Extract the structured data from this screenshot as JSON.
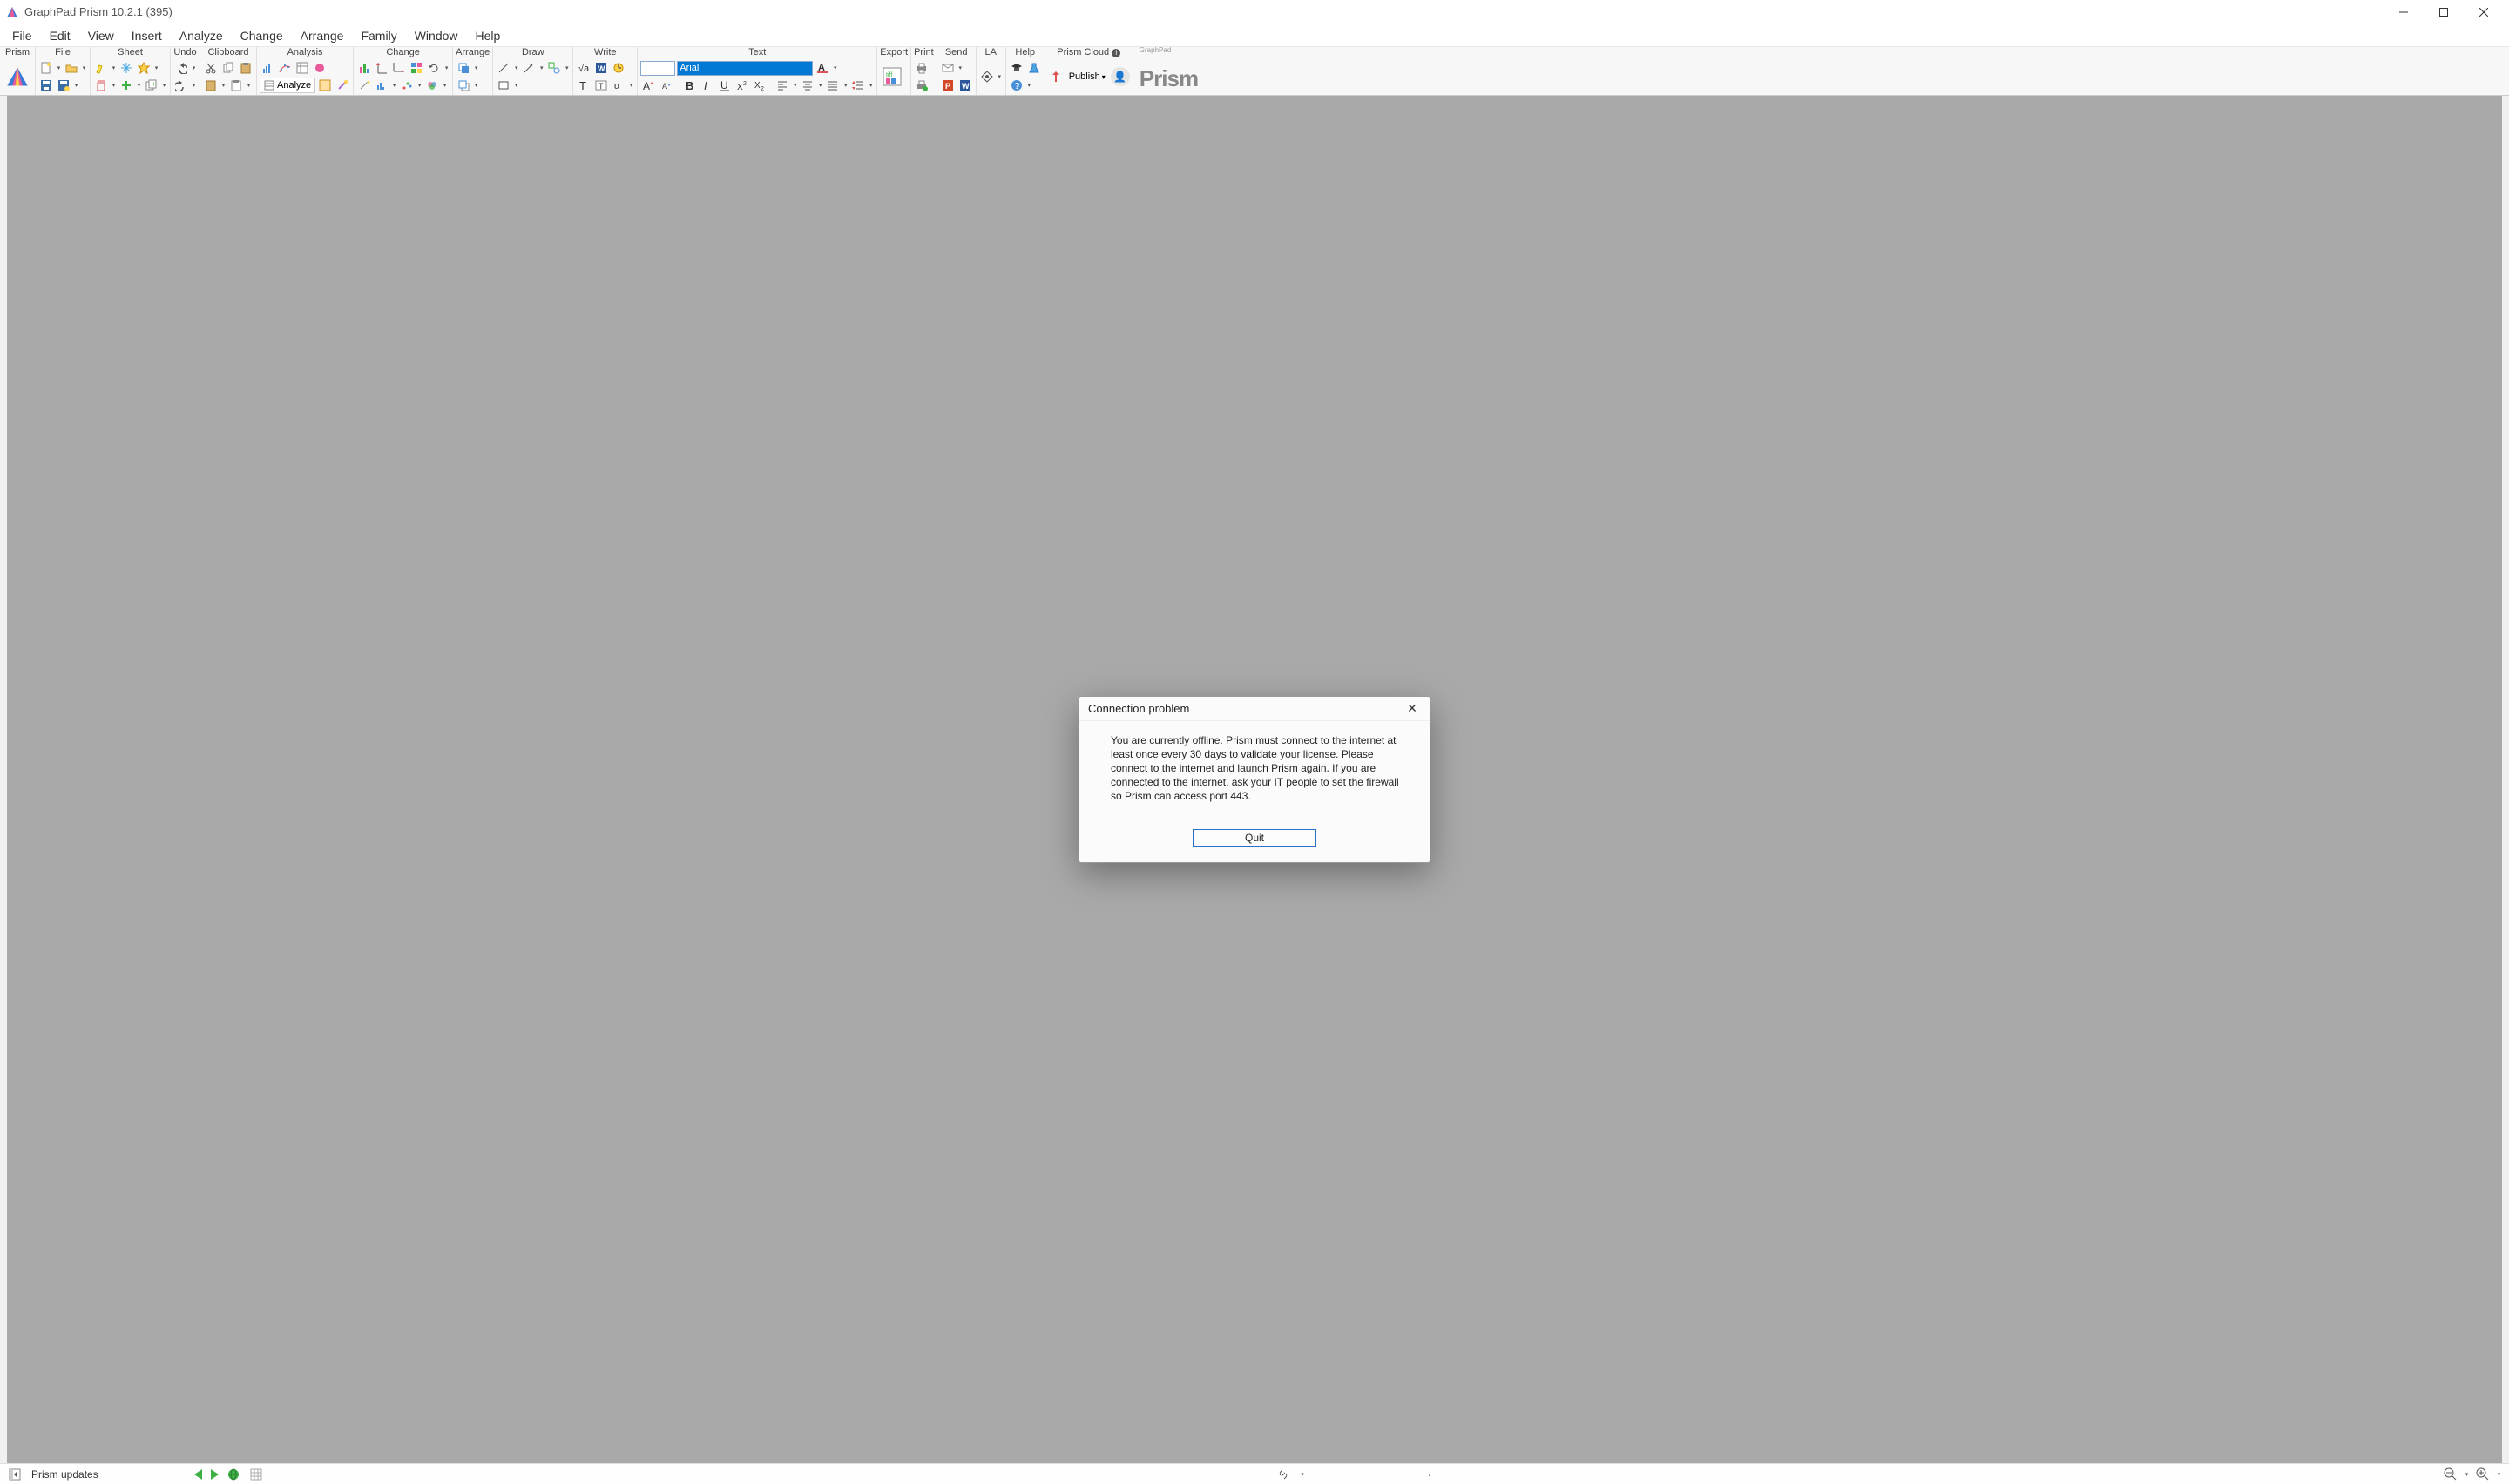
{
  "window": {
    "title": "GraphPad Prism 10.2.1 (395)"
  },
  "menu": {
    "items": [
      "File",
      "Edit",
      "View",
      "Insert",
      "Analyze",
      "Change",
      "Arrange",
      "Family",
      "Window",
      "Help"
    ]
  },
  "ribbon": {
    "groups": [
      "Prism",
      "File",
      "Sheet",
      "Undo",
      "Clipboard",
      "Analysis",
      "Change",
      "Arrange",
      "Draw",
      "Write",
      "Text",
      "Export",
      "Print",
      "Send",
      "LA",
      "Help",
      "Prism Cloud"
    ],
    "analyze_label": "Analyze",
    "font_name": "Arial",
    "font_size": "",
    "publish_label": "Publish"
  },
  "brand": {
    "name": "Prism",
    "sup": "GraphPad"
  },
  "dialog": {
    "title": "Connection problem",
    "message": "You are currently offline. Prism must connect to the internet at least once every 30 days to validate your license. Please connect to the internet and launch Prism again. If you are connected to the internet, ask your IT people to set the firewall so Prism can access port 443.",
    "button": "Quit"
  },
  "status": {
    "updates": "Prism updates"
  }
}
